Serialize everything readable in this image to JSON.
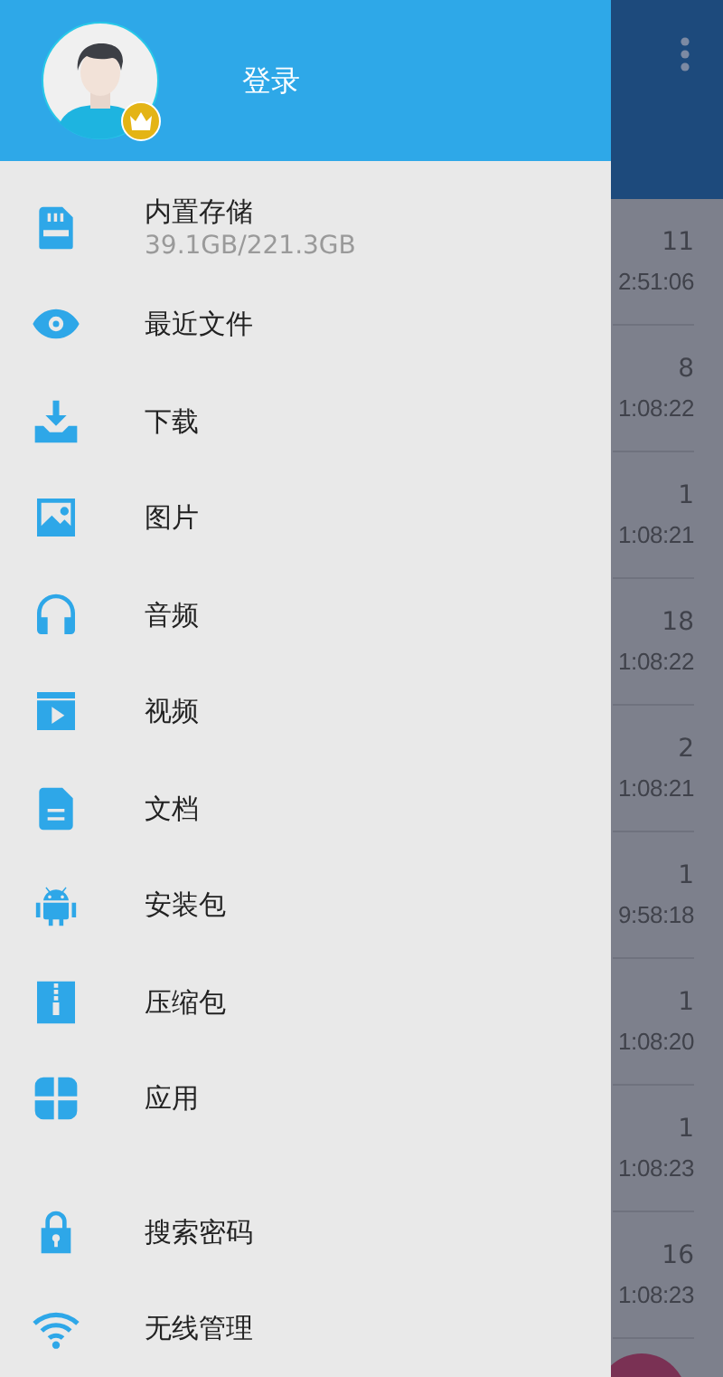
{
  "drawer": {
    "login": "登录",
    "items": [
      {
        "label": "内置存储",
        "detail": "39.1GB/221.3GB"
      },
      {
        "label": "最近文件"
      },
      {
        "label": "下载"
      },
      {
        "label": "图片"
      },
      {
        "label": "音频"
      },
      {
        "label": "视频"
      },
      {
        "label": "文档"
      },
      {
        "label": "安装包"
      },
      {
        "label": "压缩包"
      },
      {
        "label": "应用"
      }
    ],
    "tools": [
      {
        "label": "搜索密码"
      },
      {
        "label": "无线管理"
      }
    ]
  },
  "background_list": [
    {
      "count": "11",
      "time": "2:51:06"
    },
    {
      "count": "8",
      "time": "1:08:22"
    },
    {
      "count": "1",
      "time": "1:08:21"
    },
    {
      "count": "18",
      "time": "1:08:22"
    },
    {
      "count": "2",
      "time": "1:08:21"
    },
    {
      "count": "1",
      "time": "9:58:18"
    },
    {
      "count": "1",
      "time": "1:08:20"
    },
    {
      "count": "1",
      "time": "1:08:23"
    },
    {
      "count": "16",
      "time": "1:08:23"
    }
  ]
}
